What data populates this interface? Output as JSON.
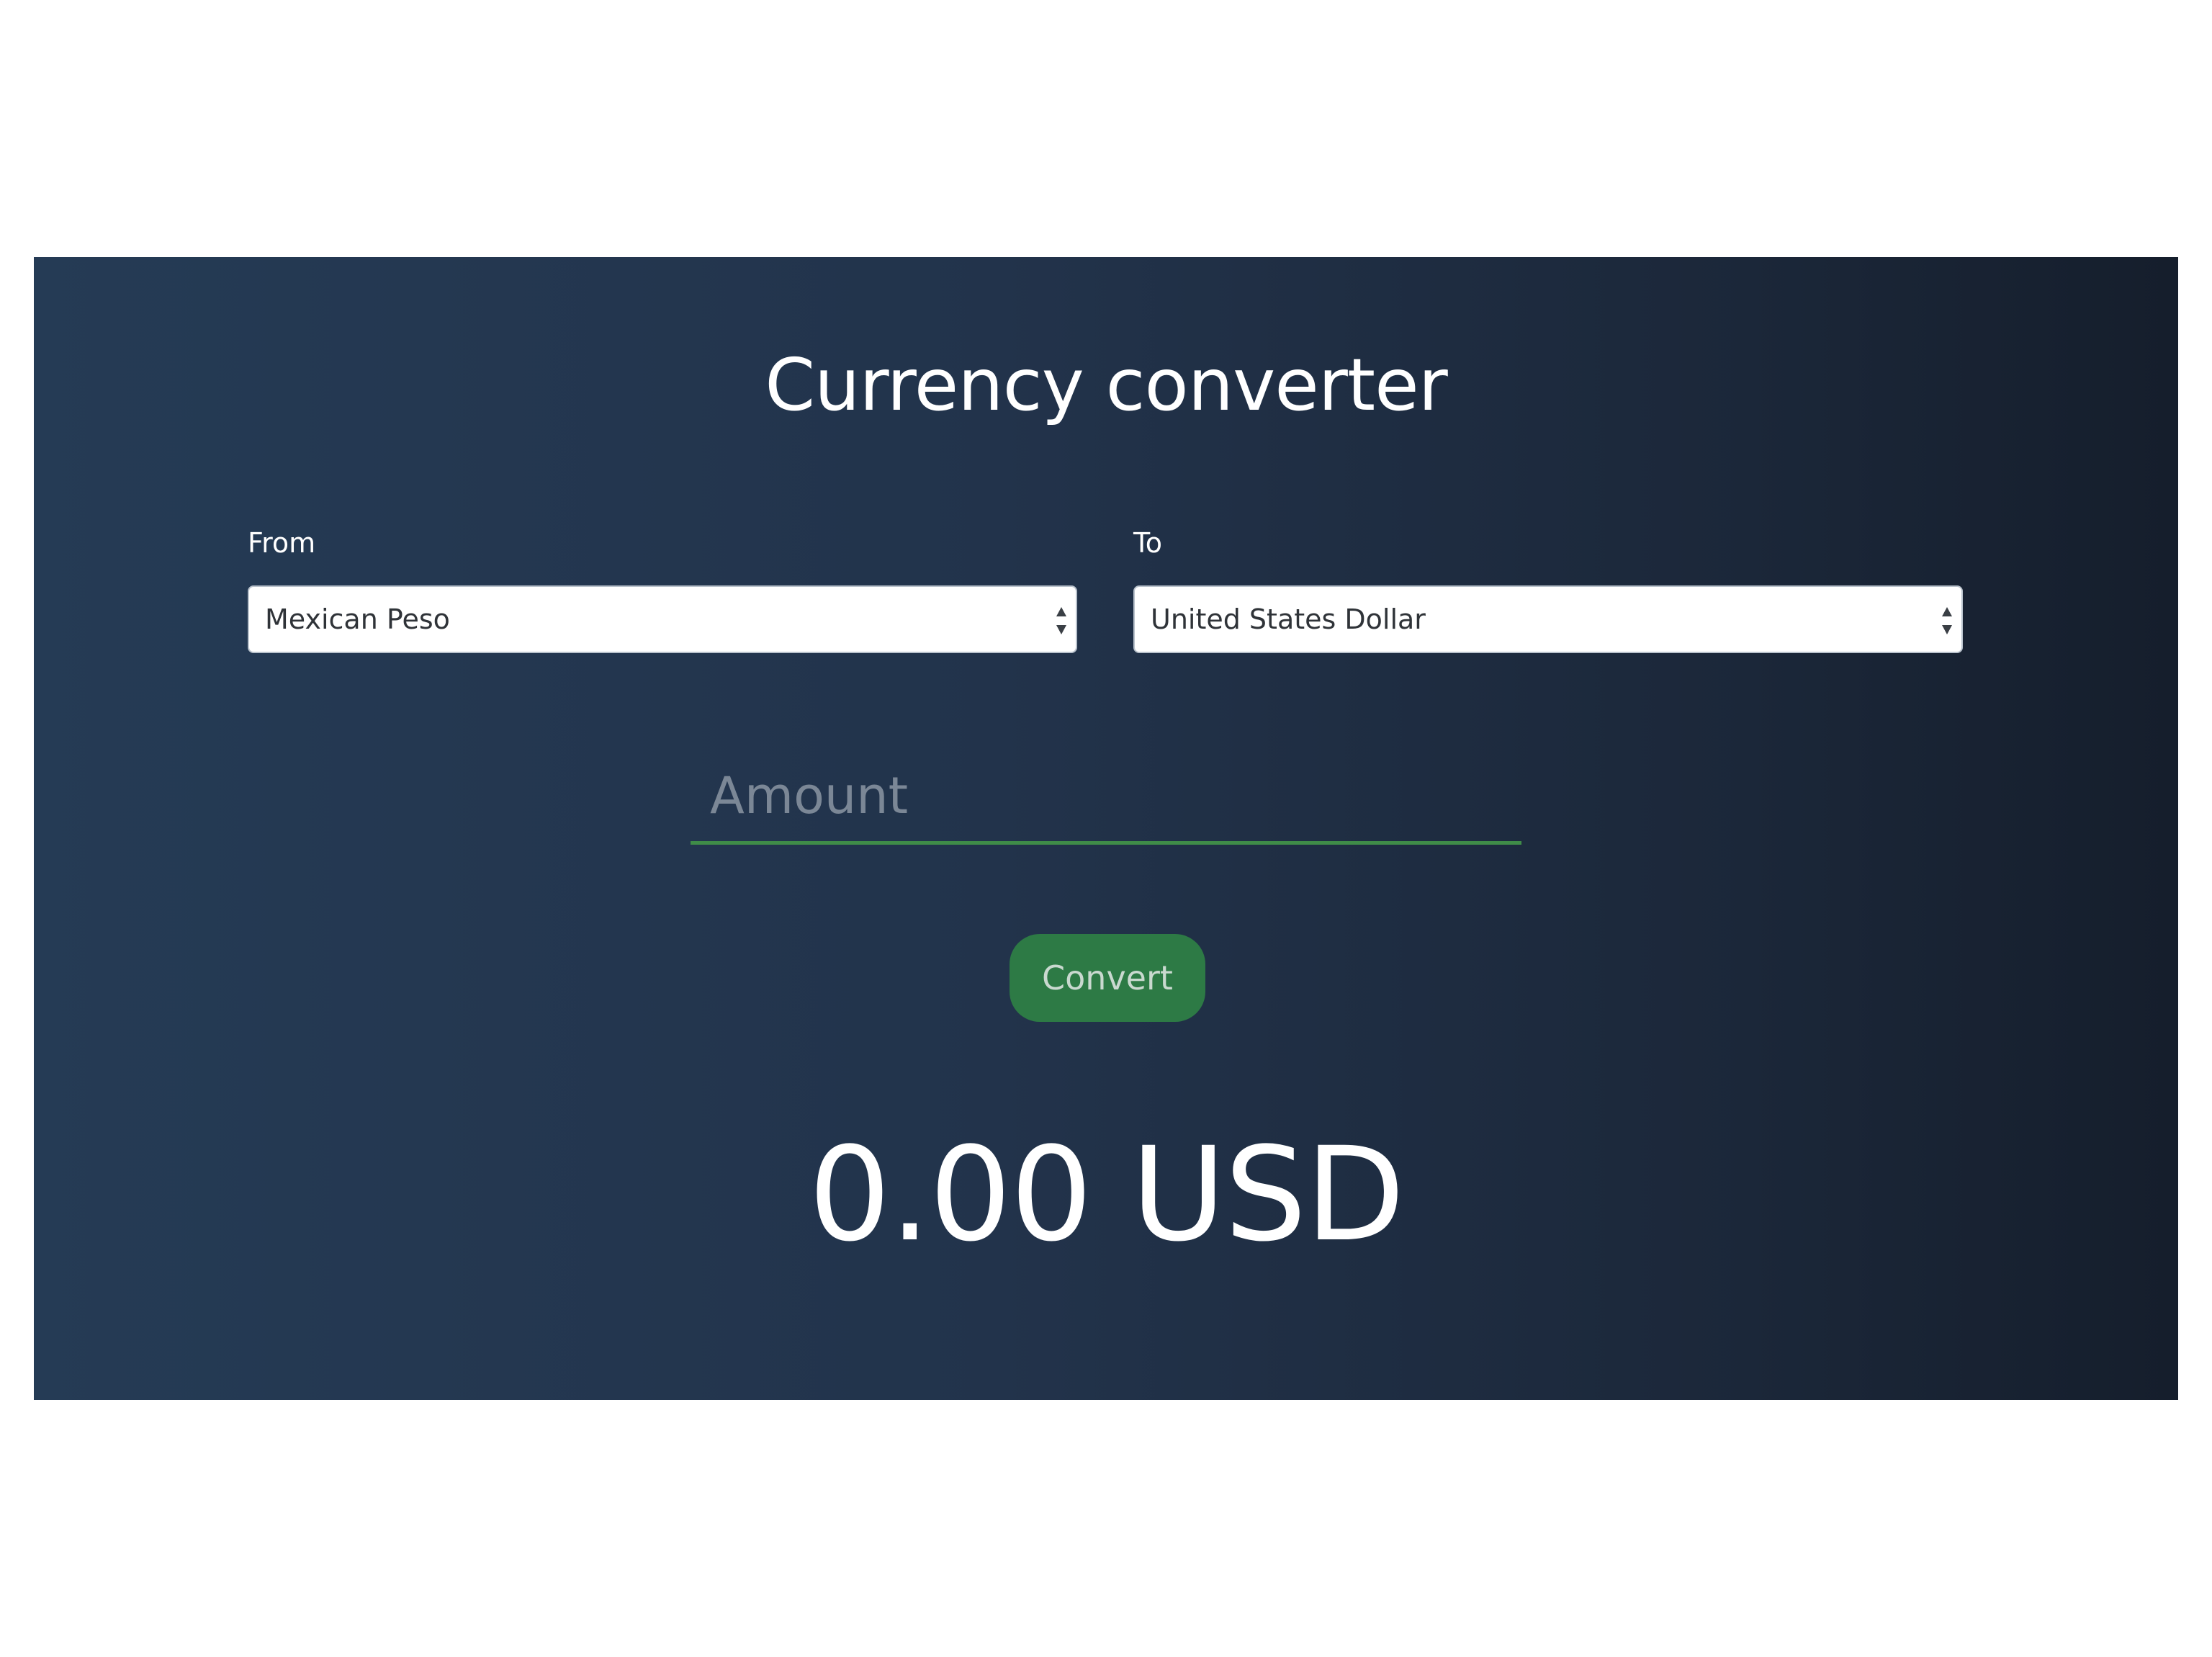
{
  "converter": {
    "title": "Currency converter",
    "from": {
      "label": "From",
      "selected": "Mexican Peso"
    },
    "to": {
      "label": "To",
      "selected": "United States Dollar"
    },
    "amount": {
      "placeholder": "Amount",
      "value": ""
    },
    "convert_label": "Convert",
    "result": "0.00 USD"
  },
  "colors": {
    "accent": "#2d7a45",
    "underline": "#3f8c48",
    "panel_start": "#253b55",
    "panel_end": "#151e2c"
  },
  "icons": {
    "select_arrows": "updown-arrows-icon"
  }
}
